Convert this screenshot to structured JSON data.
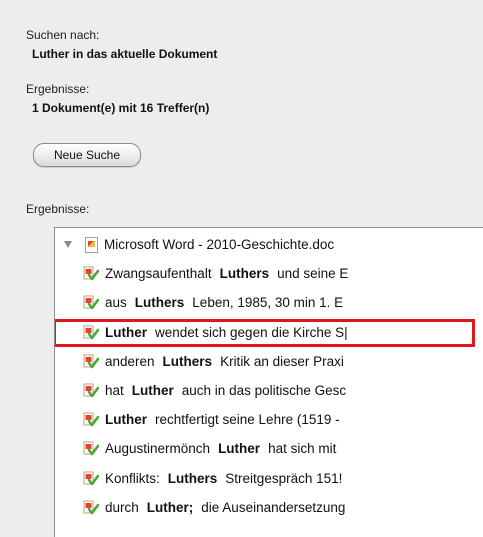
{
  "search": {
    "label": "Suchen nach:",
    "query": "Luther in das aktuelle Dokument"
  },
  "results_summary": {
    "label": "Ergebnisse:",
    "value": "1 Dokument(e) mit 16 Treffer(n)"
  },
  "new_search_button": "Neue Suche",
  "results_list_label": "Ergebnisse:",
  "tree": {
    "document": "Microsoft Word - 2010-Geschichte.doc",
    "hits": [
      {
        "before": "Zwangsaufenthalt",
        "term": "Luthers",
        "after": "und seine E"
      },
      {
        "before": "aus",
        "term": "Luthers",
        "after": "Leben, 1985, 30 min 1. E"
      },
      {
        "before": "",
        "term": "Luther",
        "after": "wendet sich gegen die Kirche S|"
      },
      {
        "before": "anderen",
        "term": "Luthers",
        "after": "Kritik an dieser Praxi"
      },
      {
        "before": "hat",
        "term": "Luther",
        "after": "auch in das politische Gesc"
      },
      {
        "before": "",
        "term": "Luther",
        "after": "rechtfertigt seine Lehre (1519 -"
      },
      {
        "before": "Augustinermönch",
        "term": "Luther",
        "after": "hat sich mit"
      },
      {
        "before": "Konflikts:",
        "term": "Luthers",
        "after": "Streitgespräch 151!"
      },
      {
        "before": "durch",
        "term": "Luther;",
        "after": "die Auseinandersetzung"
      }
    ],
    "selected_index": 2
  },
  "colors": {
    "highlight_border": "#e0161c",
    "panel_bg": "#ededed",
    "list_bg": "#ffffff"
  },
  "icons": {
    "disclosure": "disclosure-triangle-icon",
    "document": "word-document-icon",
    "hit": "search-hit-icon"
  }
}
